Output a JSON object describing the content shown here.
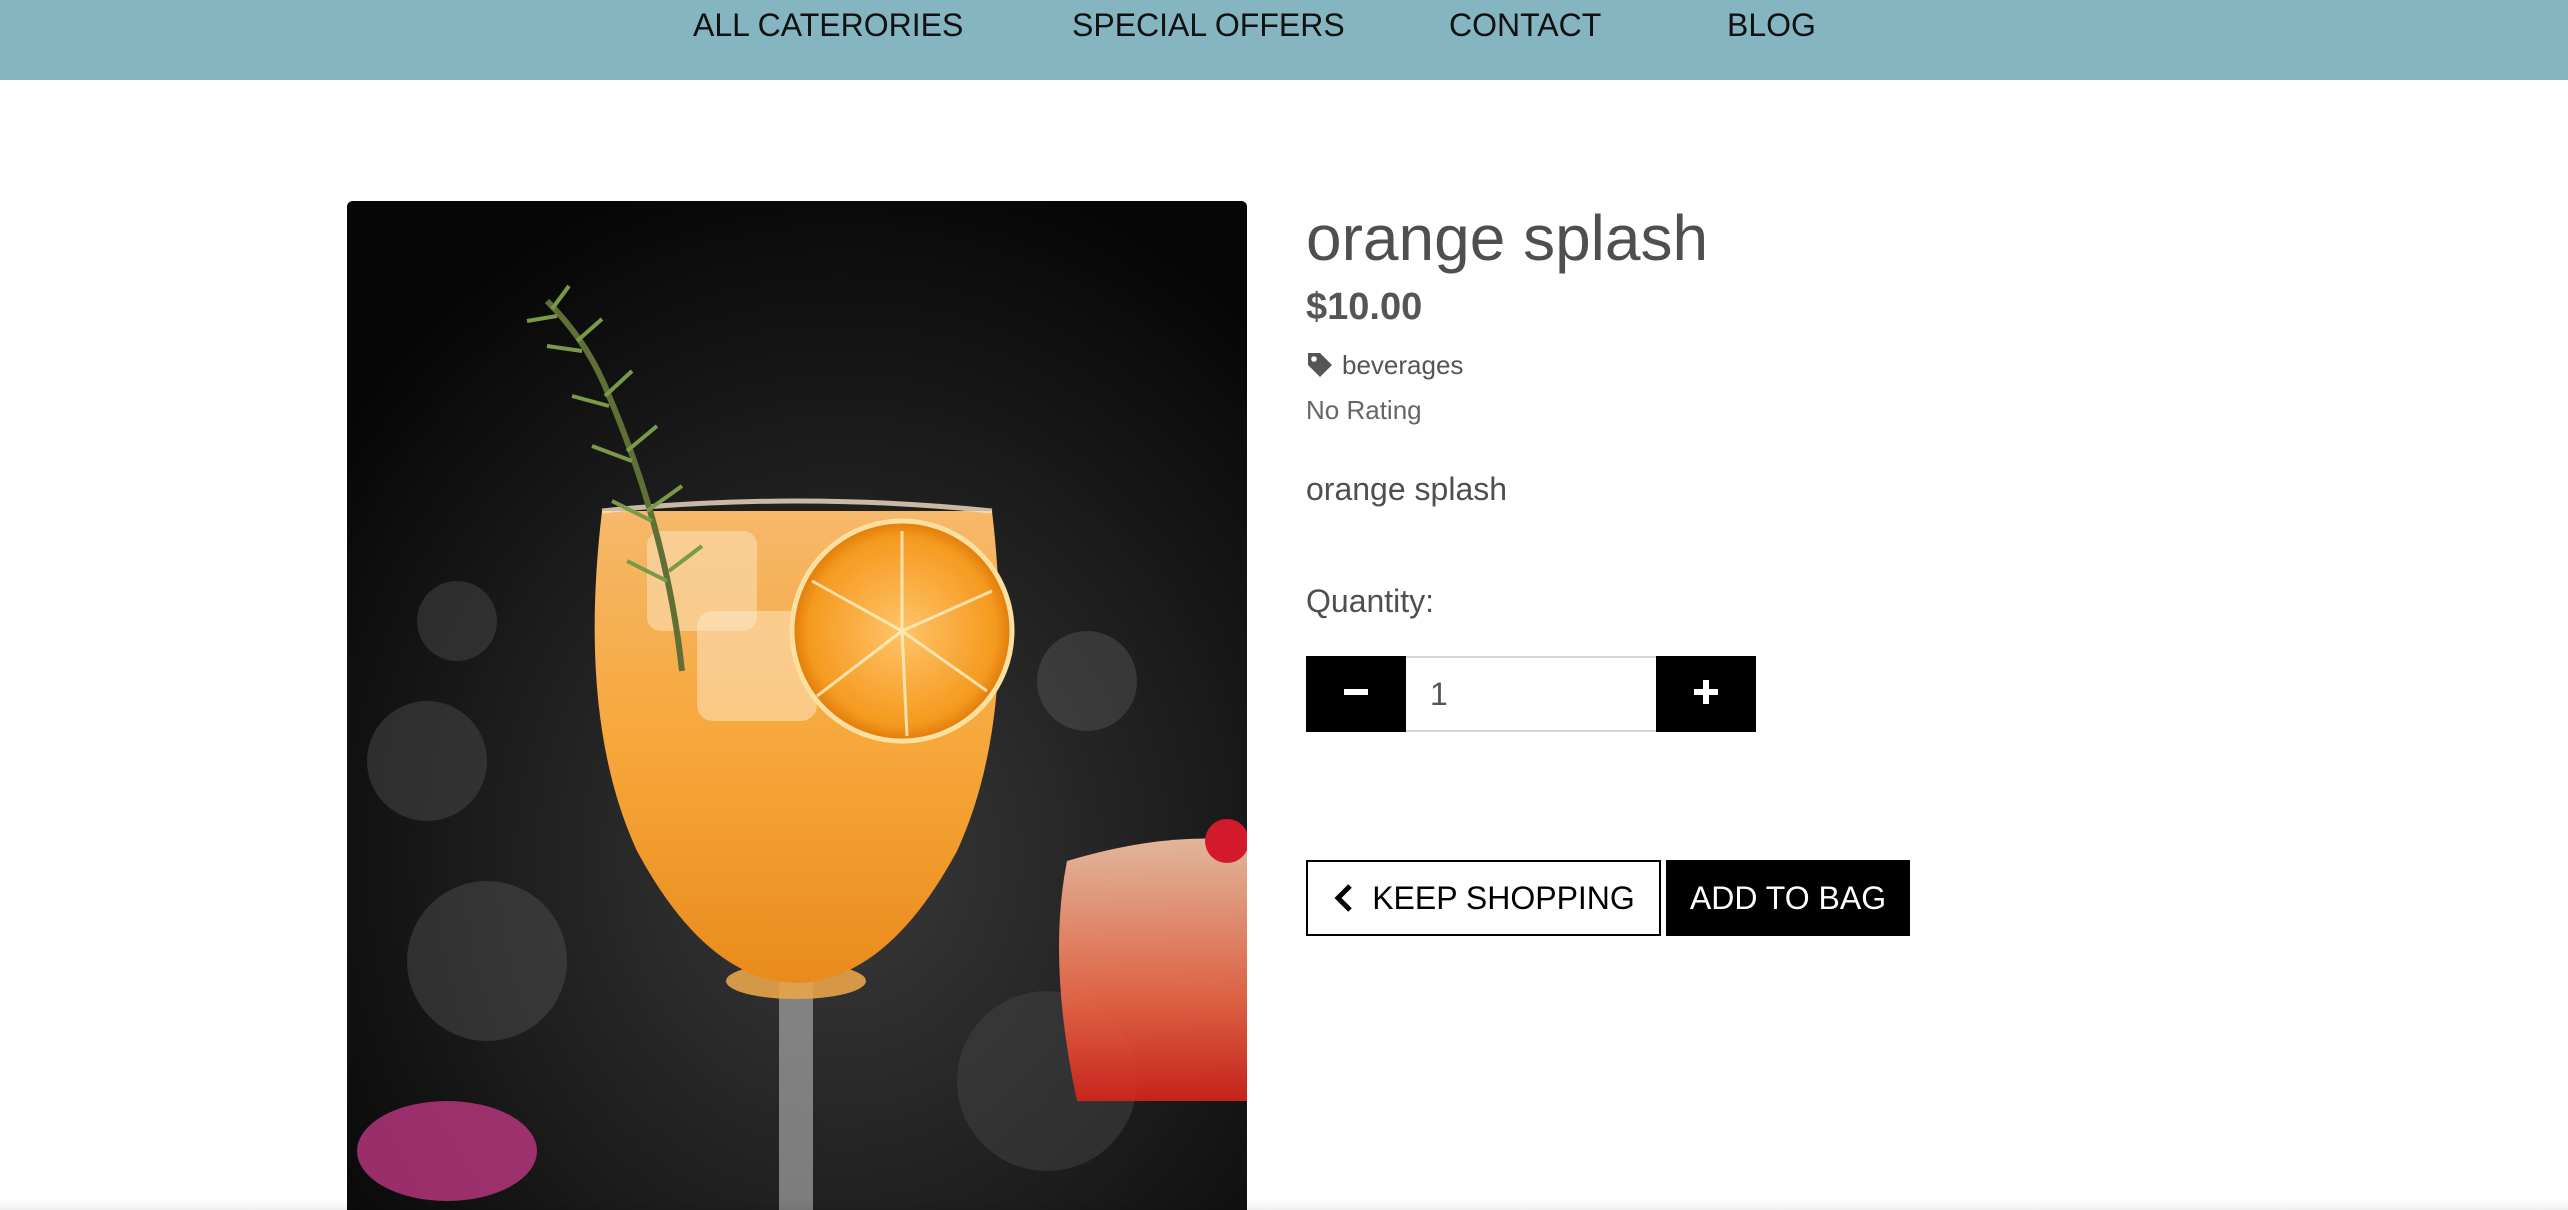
{
  "nav": {
    "items": [
      {
        "label": "ALL CATERORIES"
      },
      {
        "label": "SPECIAL OFFERS"
      },
      {
        "label": "CONTACT"
      },
      {
        "label": "BLOG"
      }
    ],
    "background_color": "#84b5c1"
  },
  "product": {
    "image_alt": "orange splash",
    "title": "orange splash",
    "price": "$10.00",
    "category": "beverages",
    "category_icon": "tag-icon",
    "rating": "No Rating",
    "description": "orange splash"
  },
  "quantity": {
    "label": "Quantity:",
    "value": "1",
    "decrement_icon": "minus-icon",
    "increment_icon": "plus-icon"
  },
  "actions": {
    "keep_shopping": "KEEP SHOPPING",
    "keep_shopping_icon": "chevron-left-icon",
    "add_to_bag": "ADD TO BAG"
  },
  "colors": {
    "accent": "#84b5c1",
    "button": "#000000",
    "text": "#555555"
  }
}
